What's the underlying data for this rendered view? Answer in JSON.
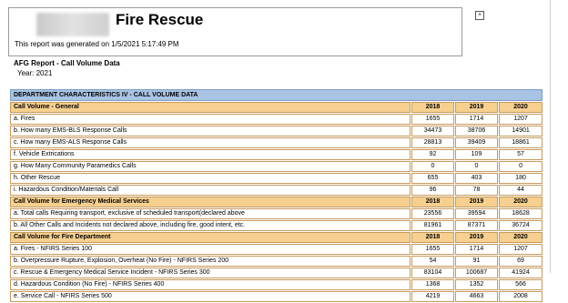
{
  "header": {
    "title": "Fire Rescue",
    "generated": "This report was generated on 1/5/2021 5:17:49 PM",
    "close_glyph": "×"
  },
  "report": {
    "title": "AFG Report - Call Volume Data",
    "year": "Year: 2021"
  },
  "table": {
    "dept_header": "DEPARTMENT CHARACTERISTICS IV - CALL VOLUME DATA",
    "years": [
      "2018",
      "2019",
      "2020"
    ],
    "sections": [
      {
        "title": "Call Volume - General",
        "rows": [
          {
            "label": "a. Fires",
            "values": [
              "1655",
              "1714",
              "1207"
            ]
          },
          {
            "label": "b. How many EMS-BLS Response Calls",
            "values": [
              "34473",
              "38706",
              "14901"
            ]
          },
          {
            "label": "c. How many EMS-ALS Response Calls",
            "values": [
              "28813",
              "39409",
              "18861"
            ]
          },
          {
            "label": "f. Vehicle Extrications",
            "values": [
              "92",
              "109",
              "57"
            ]
          },
          {
            "label": "g. How Many Community Paramedics Calls",
            "values": [
              "0",
              "0",
              "0"
            ]
          },
          {
            "label": "h. Other Rescue",
            "values": [
              "655",
              "403",
              "180"
            ]
          },
          {
            "label": "i. Hazardous Condition/Materials Call",
            "values": [
              "96",
              "78",
              "44"
            ]
          }
        ]
      },
      {
        "title": "Call Volume for Emergency Medical Services",
        "rows": [
          {
            "label": "a. Total calls Requiring transport, exclusive of scheduled transport(declared above",
            "values": [
              "23556",
              "39594",
              "18628"
            ]
          },
          {
            "label": "b. All Other Calls and Incidents not declared above, including fire, good intent, etc.",
            "values": [
              "81961",
              "87371",
              "36724"
            ]
          }
        ]
      },
      {
        "title": "Call Volume for Fire Department",
        "rows": [
          {
            "label": "a. Fires - NFIRS Series 100",
            "values": [
              "1655",
              "1714",
              "1207"
            ]
          },
          {
            "label": "b. Overpressure Rupture, Explosion, Overheat (No Fire) - NFIRS Series 200",
            "values": [
              "54",
              "91",
              "69"
            ]
          },
          {
            "label": "c. Rescue & Emergency Medical Service Incident - NFIRS Series 300",
            "values": [
              "83104",
              "100687",
              "41924"
            ]
          },
          {
            "label": "d. Hazardous Condition (No Fire) - NFIRS Series 400",
            "values": [
              "1368",
              "1352",
              "566"
            ]
          },
          {
            "label": "e. Service Call - NFIRS Series 500",
            "values": [
              "4219",
              "4663",
              "2008"
            ]
          }
        ]
      }
    ]
  }
}
